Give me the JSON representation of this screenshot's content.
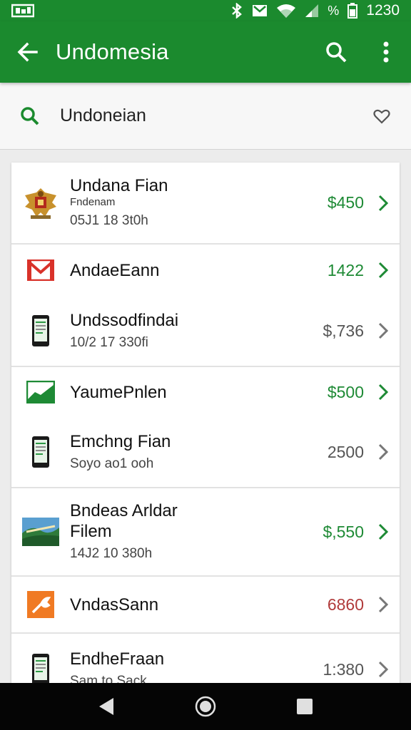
{
  "status_bar": {
    "left_icon": "gallery-icon",
    "icons": [
      "bluetooth-icon",
      "mail-icon",
      "wifi-icon"
    ],
    "battery_percent_label": "%",
    "time": "1230"
  },
  "app_bar": {
    "title": "Undomesia",
    "back_icon": "back-arrow-icon",
    "search_icon": "search-icon",
    "menu_icon": "overflow-menu-icon",
    "color": "#1b8a2e"
  },
  "search": {
    "query": "Undoneian",
    "icon": "search-icon",
    "favorite_icon": "heart-icon"
  },
  "items": [
    {
      "title": "Undana Fian",
      "subtitle_small": "Fndenam",
      "subtitle": "05J1 18 3t0h",
      "amount": "$450",
      "amount_color": "#1e8a35",
      "chevron_color": "#1e8a35",
      "icon": "coat-of-arms-icon"
    },
    {
      "title": "AndaeEann",
      "amount": "1422",
      "amount_color": "#1e8a35",
      "chevron_color": "#1e8a35",
      "icon": "gmail-icon"
    },
    {
      "title": "Undssodfindai",
      "subtitle": "10/2 17 330fi",
      "amount": "$,736",
      "amount_color": "#555555",
      "chevron_color": "#777777",
      "icon": "phone-icon"
    },
    {
      "title": "YaumePnlen",
      "amount": "$500",
      "amount_color": "#1e8a35",
      "chevron_color": "#1e8a35",
      "icon": "trend-chart-icon"
    },
    {
      "title": "Emchng Fian",
      "subtitle": "Soyo ao1 ooh",
      "amount": "2500",
      "amount_color": "#555555",
      "chevron_color": "#777777",
      "icon": "phone-icon"
    },
    {
      "title": "Bndeas Arldar",
      "title2": "Filem",
      "subtitle": "14J2 10 380h",
      "amount": "$,550",
      "amount_color": "#1e8a35",
      "chevron_color": "#1e8a35",
      "icon": "landscape-photo-icon"
    },
    {
      "title": "VndasSann",
      "amount": "6860",
      "amount_color": "#b03a3a",
      "chevron_color": "#777777",
      "icon": "tool-app-icon"
    },
    {
      "title": "EndheFraan",
      "subtitle": "Sam to Sack",
      "amount": "1:380",
      "amount_color": "#555555",
      "chevron_color": "#777777",
      "icon": "phone-icon"
    }
  ],
  "nav_bar": {
    "back": "nav-back-icon",
    "home": "nav-home-icon",
    "recents": "nav-recents-icon"
  }
}
